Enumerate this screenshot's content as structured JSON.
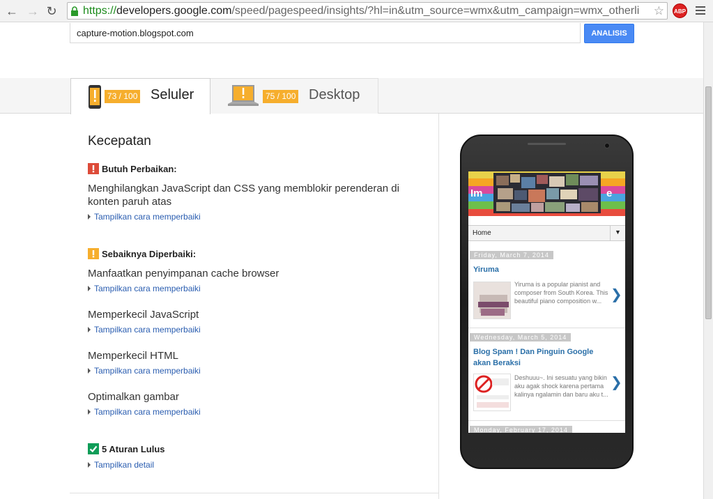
{
  "browser": {
    "url_proto": "https://",
    "url_host": "developers.google.com",
    "url_path": "/speed/pagespeed/insights/?hl=in&utm_source=wmx&utm_campaign=wmx_otherli",
    "extension_label": "ABP"
  },
  "search": {
    "value": "capture-motion.blogspot.com",
    "button_label": "ANALISIS"
  },
  "tabs": [
    {
      "label": "Seluler",
      "score": "73 / 100",
      "active": true
    },
    {
      "label": "Desktop",
      "score": "75 / 100",
      "active": false
    }
  ],
  "section_title": "Kecepatan",
  "categories": {
    "must_fix": "Butuh Perbaikan:",
    "should_fix": "Sebaiknya Diperbaiki:",
    "passed": "5 Aturan Lulus"
  },
  "rules": [
    {
      "title": "Menghilangkan JavaScript dan CSS yang memblokir perenderan di konten paruh atas",
      "link": "Tampilkan cara memperbaiki"
    },
    {
      "title": "Manfaatkan penyimpanan cache browser",
      "link": "Tampilkan cara memperbaiki"
    },
    {
      "title": "Memperkecil JavaScript",
      "link": "Tampilkan cara memperbaiki"
    },
    {
      "title": "Memperkecil HTML",
      "link": "Tampilkan cara memperbaiki"
    },
    {
      "title": "Optimalkan gambar",
      "link": "Tampilkan cara memperbaiki"
    }
  ],
  "passed_link": "Tampilkan detail",
  "preview": {
    "nav_label": "Home",
    "posts": [
      {
        "date": "Friday, March 7, 2014",
        "title": "Yiruma",
        "excerpt": "Yiruma is a popular pianist and composer from South Korea. This beautiful piano composition w..."
      },
      {
        "date": "Wednesday, March 5, 2014",
        "title": "Blog Spam ! Dan Pinguin Google akan Beraksi",
        "excerpt": "Deshuuu~. Ini sesuatu yang bikin aku agak shock karena pertama kalinya ngalamin dan baru aku t..."
      },
      {
        "date": "Monday, February 17, 2014"
      }
    ]
  },
  "colors": {
    "accent": "#4a8af4",
    "warning": "#f6ae2d",
    "error": "#dd4b39",
    "pass": "#0f9d58",
    "link": "#2a5db0"
  }
}
